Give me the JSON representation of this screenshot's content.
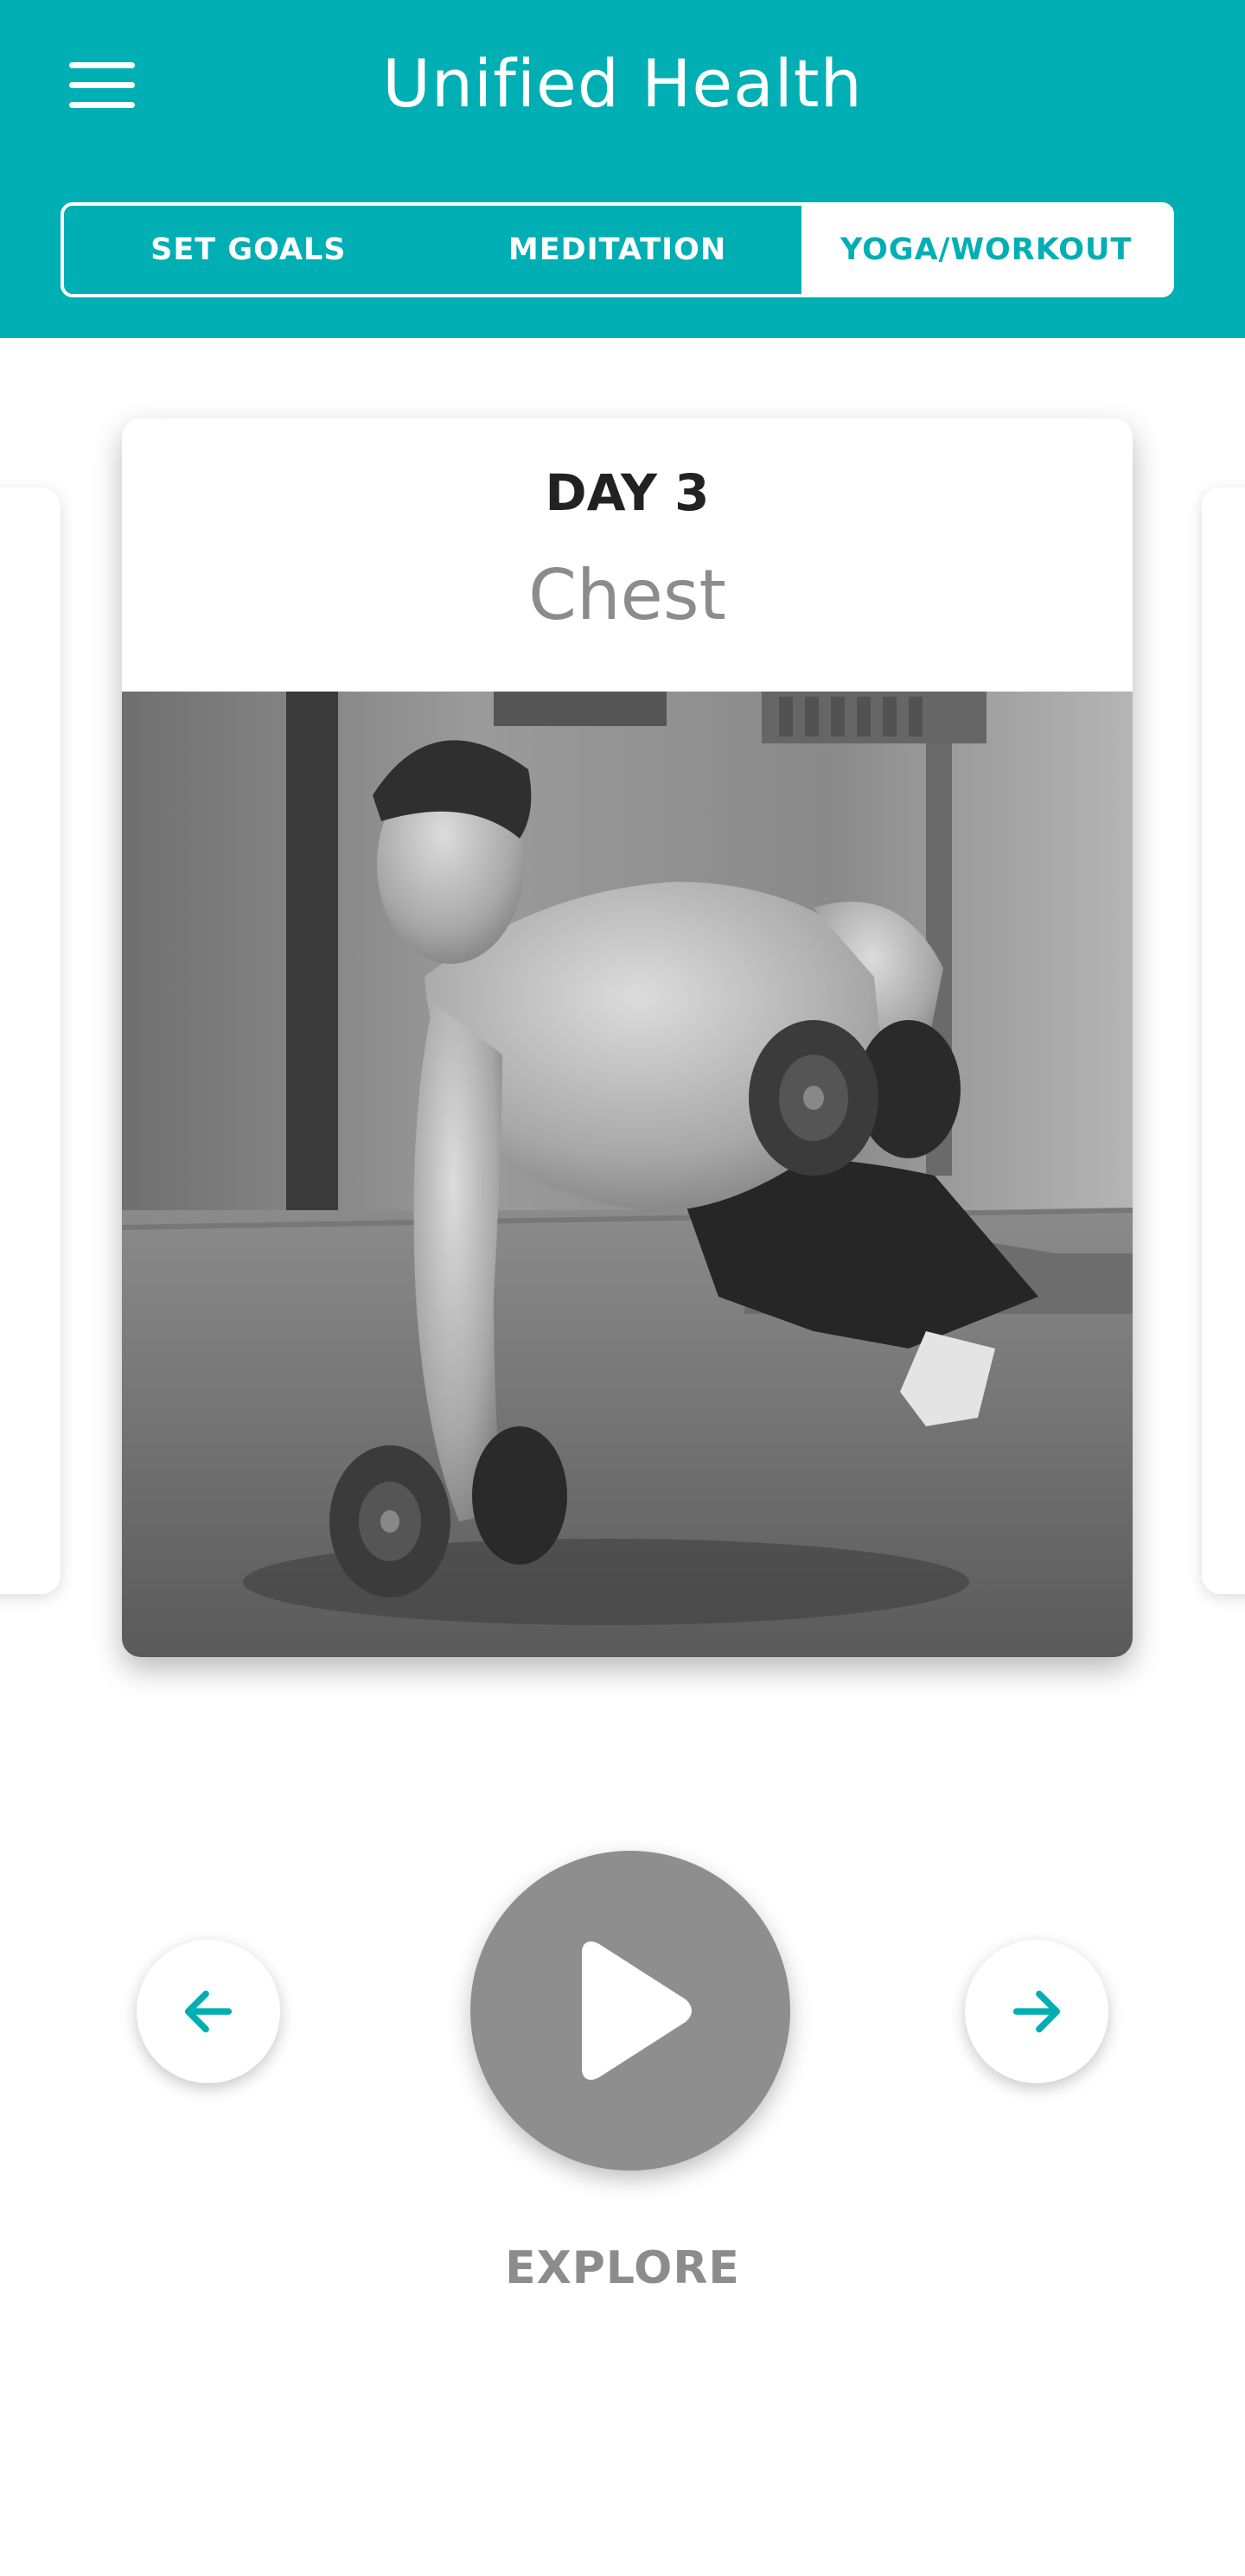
{
  "header": {
    "title": "Unified Health",
    "menu_icon": "hamburger-menu-icon",
    "bg_color": "#00AFB3"
  },
  "tabs": [
    {
      "label": "SET GOALS",
      "active": false
    },
    {
      "label": "MEDITATION",
      "active": false
    },
    {
      "label": "YOGA/WORKOUT",
      "active": true
    }
  ],
  "carousel": {
    "current": {
      "day": "DAY 3",
      "muscle": "Chest",
      "image": "man doing push-up with dumbbell row (grayscale)"
    }
  },
  "controls": {
    "prev_icon": "arrow-left-icon",
    "play_icon": "play-icon",
    "next_icon": "arrow-right-icon",
    "explore_label": "EXPLORE"
  },
  "colors": {
    "accent": "#00AFB3",
    "play_button": "#8E8E8E",
    "title_text": "#222222",
    "subtitle_text": "#8C8C8C"
  }
}
